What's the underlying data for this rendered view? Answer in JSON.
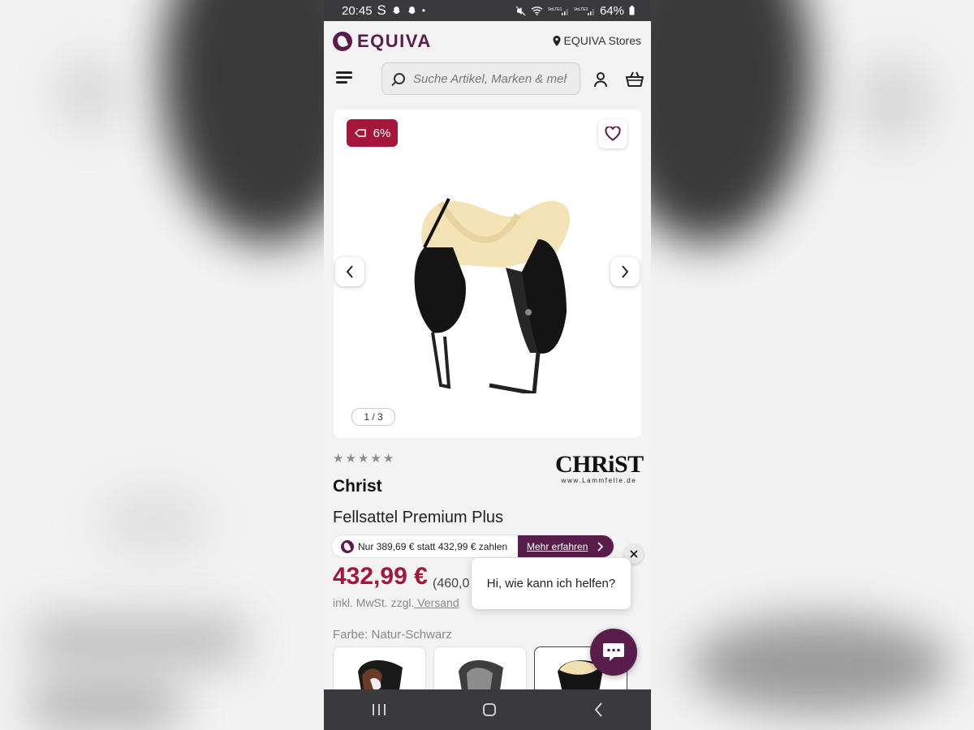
{
  "status_bar": {
    "time": "20:45",
    "left_icons": "S",
    "dot": "•",
    "battery": "64%"
  },
  "header": {
    "logo_text": "EQUIVA",
    "stores_label": "EQUIVA Stores",
    "search_placeholder": "Suche Artikel, Marken & mehr"
  },
  "gallery": {
    "discount_badge": "6%",
    "pager": "1 / 3"
  },
  "product": {
    "brand_logo_text": "CHRiST",
    "brand_logo_sub": "www.Lammfelle.de",
    "brand": "Christ",
    "title": "Fellsattel Premium Plus",
    "rating_stars": 0,
    "price": "432,99 €",
    "uvp": "(460,0",
    "vat_text": "inkl. MwSt. zzgl.",
    "shipping_link": " Versand",
    "color_label": "Farbe: Natur-Schwarz"
  },
  "promo": {
    "text": "Nur 389,69 € statt 432,99 € zahlen",
    "link": "Mehr erfahren"
  },
  "chat": {
    "greeting": "Hi, wie kann ich helfen?"
  },
  "colors": {
    "brand": "#5a1d4b",
    "price": "#a6163a",
    "badge": "#a6163a"
  }
}
